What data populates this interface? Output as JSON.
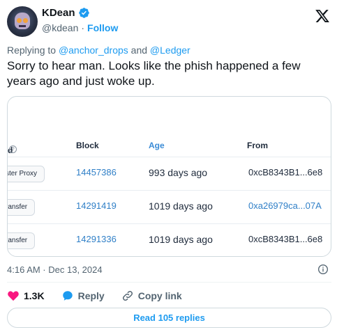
{
  "author": {
    "display_name": "KDean",
    "handle": "@kdean",
    "separator": "·",
    "follow_label": "Follow"
  },
  "reply": {
    "prefix": "Replying to",
    "mention1": "@anchor_drops",
    "conjunction": "and",
    "mention2": "@Ledger"
  },
  "tweet_text": "Sorry to hear man. Looks like the phish happened a few years ago and just woke up.",
  "table": {
    "headers": {
      "method": "d",
      "help": "?",
      "block": "Block",
      "age": "Age",
      "from": "From"
    },
    "rows": [
      {
        "method": "ster Proxy",
        "block": "14457386",
        "age": "993 days ago",
        "from": "0xcB8343B1...6e8",
        "from_link": false
      },
      {
        "method": "ransfer",
        "block": "14291419",
        "age": "1019 days ago",
        "from": "0xa26979ca...07A",
        "from_link": true
      },
      {
        "method": "ransfer",
        "block": "14291336",
        "age": "1019 days ago",
        "from": "0xcB8343B1...6e8",
        "from_link": false
      }
    ]
  },
  "timestamp": "4:16 AM · Dec 13, 2024",
  "actions": {
    "likes": "1.3K",
    "reply_label": "Reply",
    "copy_label": "Copy link"
  },
  "read_replies": "Read 105 replies",
  "colors": {
    "accent": "#1d9bf0",
    "like": "#f91880",
    "muted": "#536471"
  },
  "icons": [
    "verified-badge-icon",
    "x-logo-icon",
    "help-icon",
    "info-icon",
    "heart-icon",
    "reply-icon",
    "link-icon"
  ]
}
